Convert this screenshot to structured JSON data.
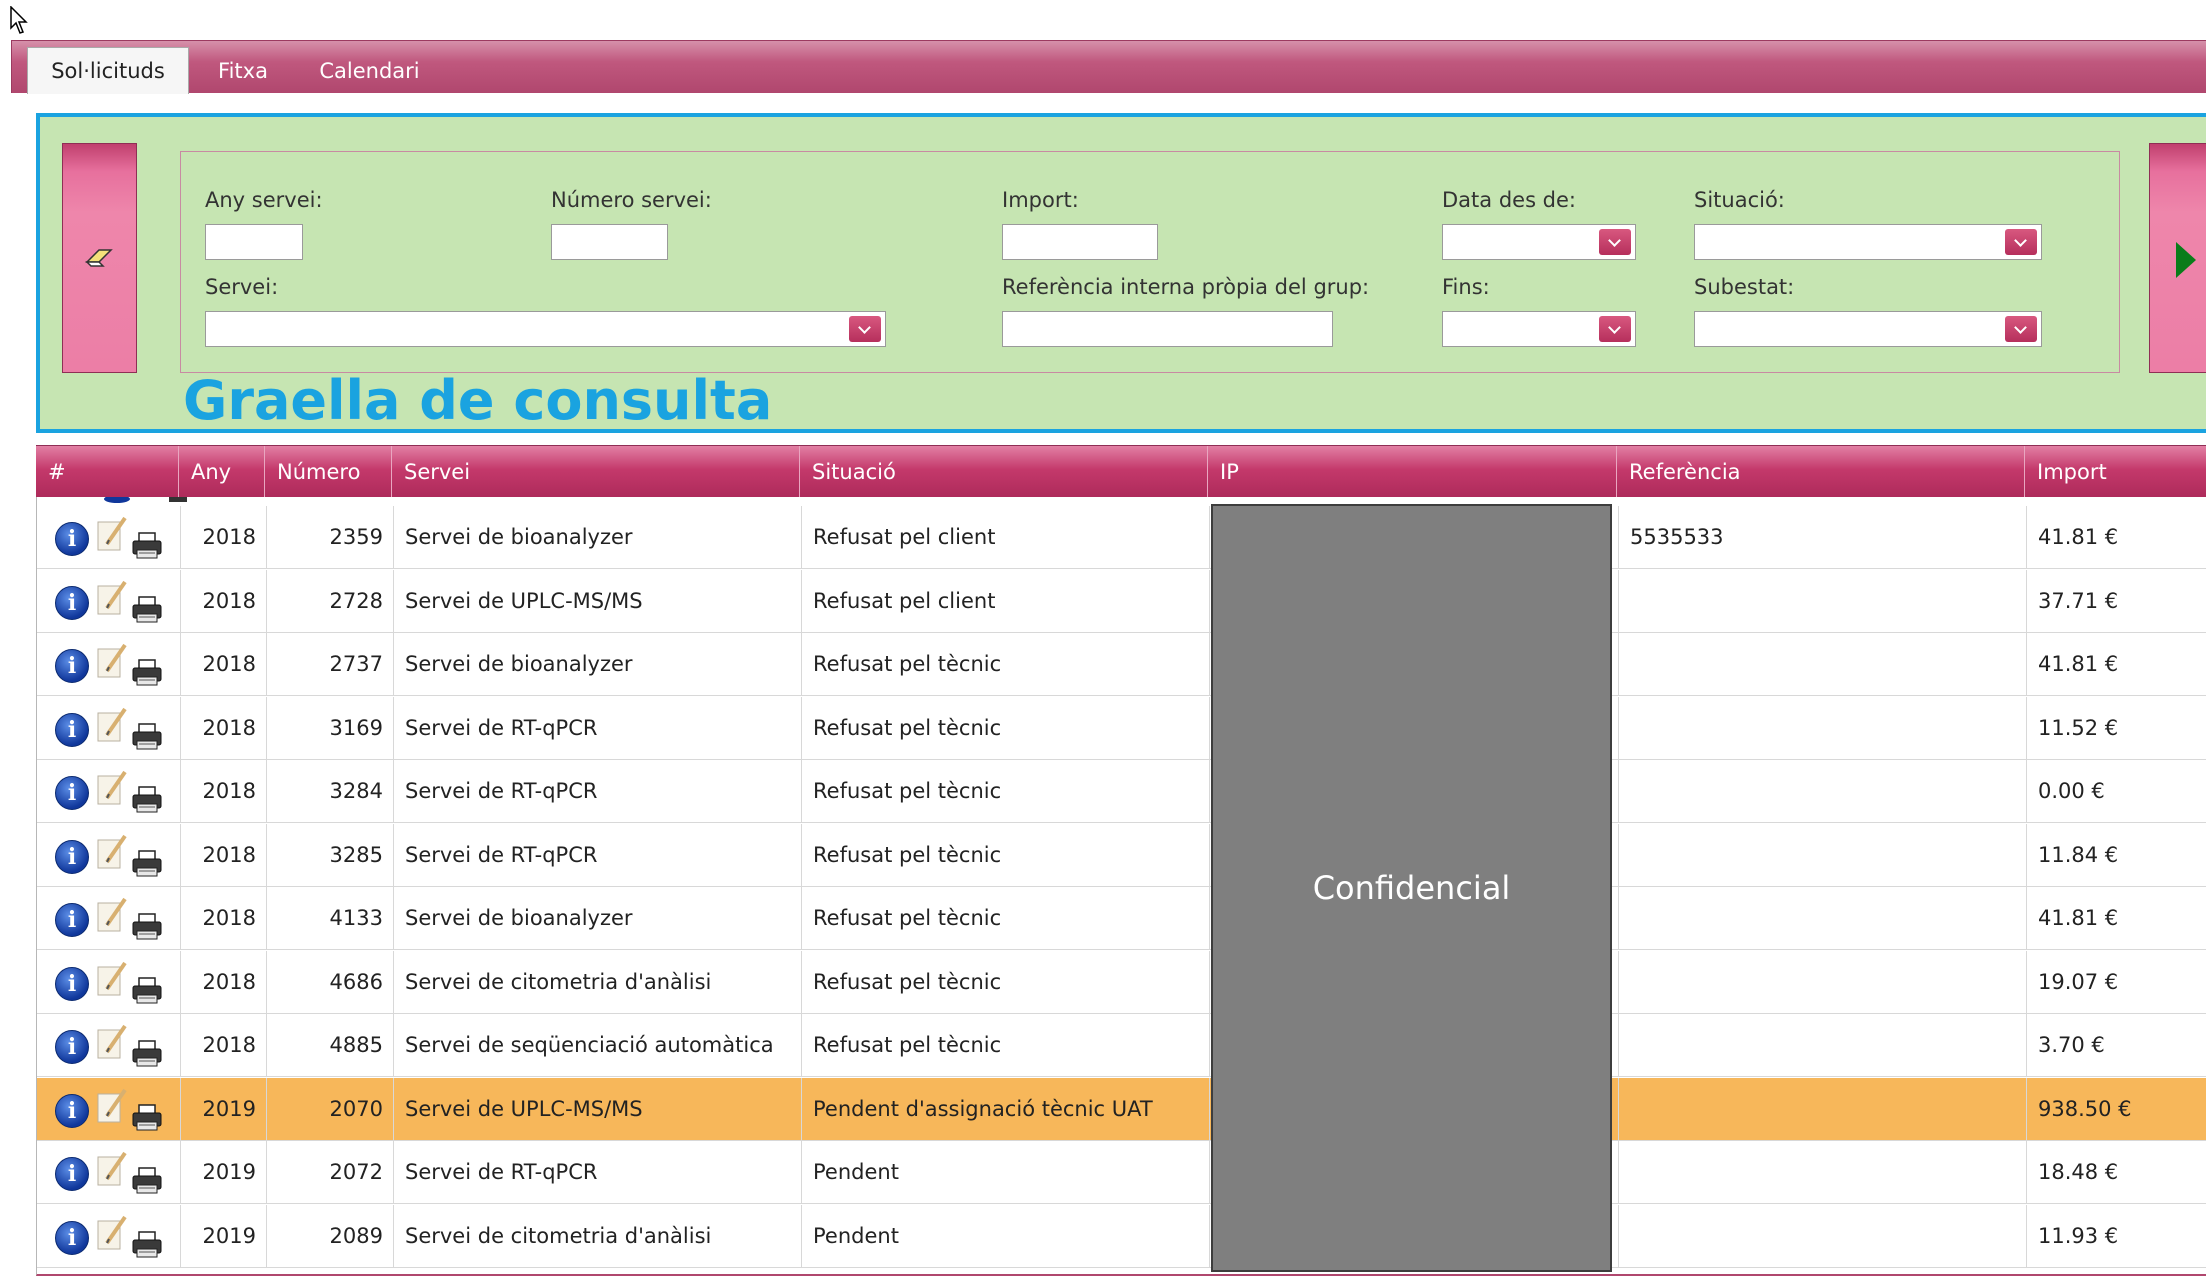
{
  "tabs": [
    {
      "label": "Sol·licituds",
      "active": true
    },
    {
      "label": "Fitxa",
      "active": false
    },
    {
      "label": "Calendari",
      "active": false
    }
  ],
  "filters": {
    "any_servei_label": "Any servei:",
    "numero_servei_label": "Número servei:",
    "import_label": "Import:",
    "data_des_de_label": "Data des de:",
    "situacio_label": "Situació:",
    "servei_label": "Servei:",
    "referencia_label": "Referència interna pròpia del grup:",
    "fins_label": "Fins:",
    "subestat_label": "Subestat:"
  },
  "panel_caption": "Graella de consulta",
  "table": {
    "headers": [
      "#",
      "Any",
      "Número",
      "Servei",
      "Situació",
      "IP",
      "Referència",
      "Import"
    ],
    "rows": [
      {
        "any": "2018",
        "numero": "2359",
        "servei": "Servei de bioanalyzer",
        "situacio": "Refusat pel client",
        "referencia": "5535533",
        "import": "41.81 €",
        "highlight": false
      },
      {
        "any": "2018",
        "numero": "2728",
        "servei": "Servei de UPLC-MS/MS",
        "situacio": "Refusat pel client",
        "referencia": "",
        "import": "37.71 €",
        "highlight": false
      },
      {
        "any": "2018",
        "numero": "2737",
        "servei": "Servei de bioanalyzer",
        "situacio": "Refusat pel tècnic",
        "referencia": "",
        "import": "41.81 €",
        "highlight": false
      },
      {
        "any": "2018",
        "numero": "3169",
        "servei": "Servei de RT-qPCR",
        "situacio": "Refusat pel tècnic",
        "referencia": "",
        "import": "11.52 €",
        "highlight": false
      },
      {
        "any": "2018",
        "numero": "3284",
        "servei": "Servei de RT-qPCR",
        "situacio": "Refusat pel tècnic",
        "referencia": "",
        "import": "0.00 €",
        "highlight": false
      },
      {
        "any": "2018",
        "numero": "3285",
        "servei": "Servei de RT-qPCR",
        "situacio": "Refusat pel tècnic",
        "referencia": "",
        "import": "11.84 €",
        "highlight": false
      },
      {
        "any": "2018",
        "numero": "4133",
        "servei": "Servei de bioanalyzer",
        "situacio": "Refusat pel tècnic",
        "referencia": "",
        "import": "41.81 €",
        "highlight": false
      },
      {
        "any": "2018",
        "numero": "4686",
        "servei": "Servei de citometria d'anàlisi",
        "situacio": "Refusat pel tècnic",
        "referencia": "",
        "import": "19.07 €",
        "highlight": false
      },
      {
        "any": "2018",
        "numero": "4885",
        "servei": "Servei de seqüenciació automàtica",
        "situacio": "Refusat pel tècnic",
        "referencia": "",
        "import": "3.70 €",
        "highlight": false
      },
      {
        "any": "2019",
        "numero": "2070",
        "servei": "Servei de UPLC-MS/MS",
        "situacio": "Pendent d'assignació tècnic UAT",
        "referencia": "",
        "import": "938.50 €",
        "highlight": true
      },
      {
        "any": "2019",
        "numero": "2072",
        "servei": "Servei de RT-qPCR",
        "situacio": "Pendent",
        "referencia": "",
        "import": "18.48 €",
        "highlight": false
      },
      {
        "any": "2019",
        "numero": "2089",
        "servei": "Servei de citometria d'anàlisi",
        "situacio": "Pendent",
        "referencia": "",
        "import": "11.93 €",
        "highlight": false
      }
    ]
  },
  "confidential_label": "Confidencial",
  "colors": {
    "tab_bar": "#c0587e",
    "panel_bg": "#c6e5b2",
    "panel_border": "#1aa3e0",
    "caption": "#1aa3e0",
    "highlight_row": "#f7b75a",
    "redaction": "#7f7f7f"
  },
  "icons": {
    "row_actions": [
      "info-icon",
      "edit-icon",
      "print-icon"
    ],
    "filter_clear": "eraser-icon",
    "filter_run": "play-icon"
  }
}
